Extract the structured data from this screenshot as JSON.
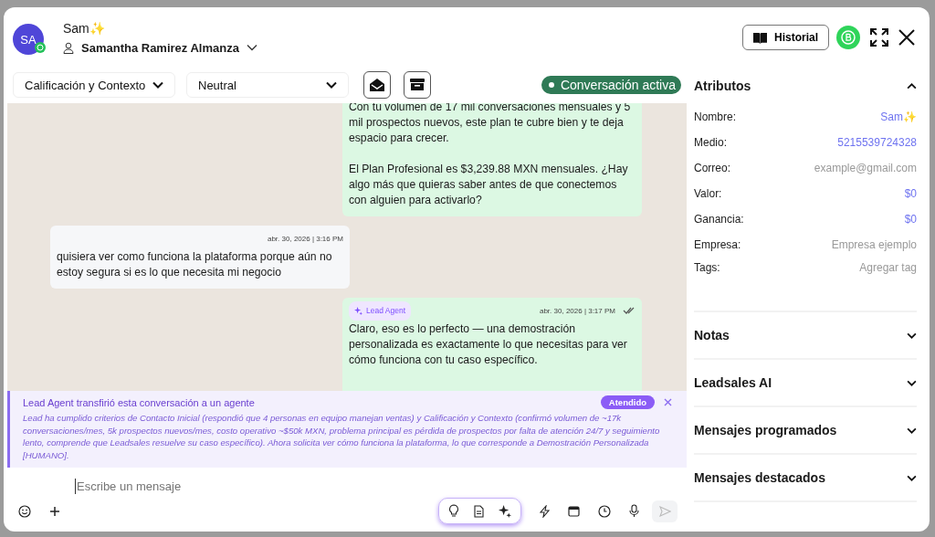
{
  "contact": {
    "initials": "SA",
    "nickname": "Sam✨",
    "full_name": "Samantha Ramirez Almanza"
  },
  "header": {
    "history_button": "Historial"
  },
  "toolbar": {
    "stage": "Calificación y Contexto",
    "sentiment": "Neutral",
    "status": "Conversación activa"
  },
  "messages": [
    {
      "kind": "out",
      "paragraphs": [
        "Con tu volumen de 17 mil conversaciones mensuales y 5 mil prospectos nuevos, este plan te cubre bien y te deja espacio para crecer.",
        "El Plan Profesional es $3,239.88 MXN mensuales. ¿Hay algo más que quieras saber antes de que conectemos con alguien para activarlo?"
      ]
    },
    {
      "kind": "in",
      "time": "abr. 30, 2026 | 3:16 PM",
      "paragraphs": [
        "quisiera ver como funciona la plataforma porque aún no estoy segura si es lo que necesita mi negocio"
      ]
    },
    {
      "kind": "out",
      "agent": "Lead Agent",
      "time": "abr. 30, 2026 | 3:17 PM",
      "read": true,
      "paragraphs": [
        "Claro, eso es lo perfecto — una demostración personalizada es exactamente lo que necesitas para ver cómo funciona con tu caso específico."
      ]
    }
  ],
  "handoff": {
    "title": "Lead Agent transfirió esta conversación a un agente",
    "badge": "Atendido",
    "body": "Lead ha cumplido criterios de Contacto Inicial (respondió que 4 personas en equipo manejan ventas) y Calificación y Contexto (confirmó volumen de ~17k conversaciones/mes, 5k prospectos nuevos/mes, costo operativo ~$50k MXN, problema principal es pérdida de prospectos por falta de atención 24/7 y seguimiento lento, comprende que Leadsales resuelve su caso específico). Ahora solicita ver cómo funciona la plataforma, lo que corresponde a Demostración Personalizada [HUMANO]."
  },
  "composer": {
    "placeholder": "Escribe un mensaje"
  },
  "attributes": {
    "title": "Atributos",
    "expanded": true,
    "rows": [
      {
        "label": "Nombre:",
        "value": "Sam✨",
        "kind": "link"
      },
      {
        "label": "Medio:",
        "value": "5215539724328",
        "kind": "link"
      },
      {
        "label": "Correo:",
        "value": "example@gmail.com",
        "kind": "placeholder"
      },
      {
        "label": "Valor:",
        "value": "$0",
        "kind": "link"
      },
      {
        "label": "Ganancia:",
        "value": "$0",
        "kind": "link"
      },
      {
        "label": "Empresa:",
        "value": "Empresa ejemplo",
        "kind": "placeholder"
      },
      {
        "label": "Tags:",
        "value": "Agregar tag",
        "kind": "placeholder"
      }
    ]
  },
  "sections": [
    {
      "title": "Notas",
      "expanded": false
    },
    {
      "title": "Leadsales AI",
      "expanded": false
    },
    {
      "title": "Mensajes programados",
      "expanded": false
    },
    {
      "title": "Mensajes destacados",
      "expanded": false
    }
  ]
}
